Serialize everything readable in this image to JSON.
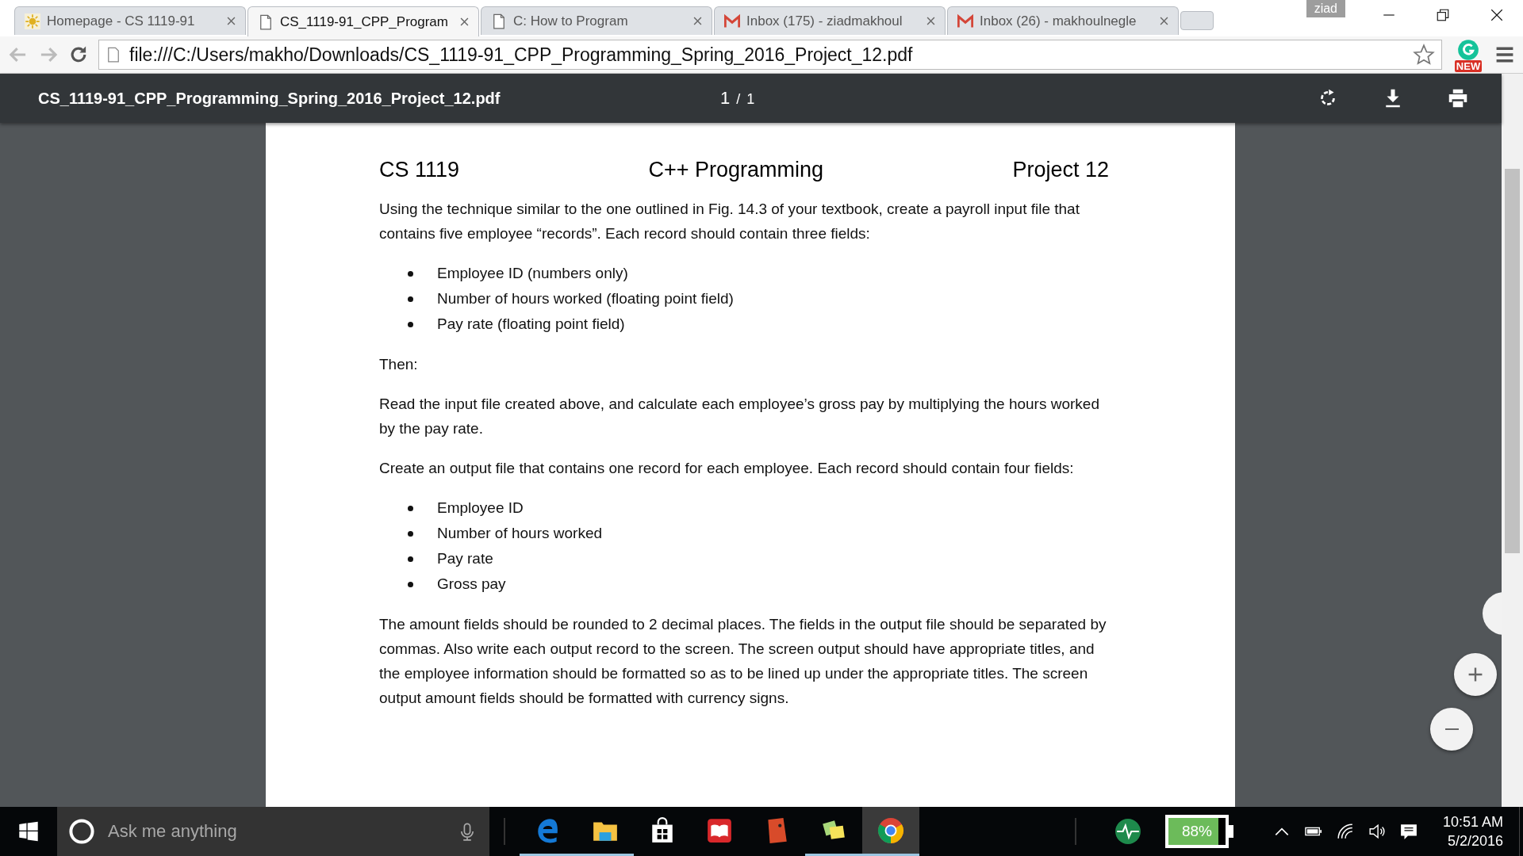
{
  "browser": {
    "tabs": [
      {
        "title": "Homepage - CS 1119-91",
        "kind": "site",
        "selected": false
      },
      {
        "title": "CS_1119-91_CPP_Program",
        "kind": "document",
        "selected": true
      },
      {
        "title": "C: How to Program",
        "kind": "document",
        "selected": false
      },
      {
        "title": "Inbox (175) - ziadmakhoul",
        "kind": "mail",
        "selected": false
      },
      {
        "title": "Inbox (26) - makhoulnegle",
        "kind": "mail",
        "selected": false
      }
    ],
    "profile_name": "ziad",
    "address": "file:///C:/Users/makho/Downloads/CS_1119-91_CPP_Programming_Spring_2016_Project_12.pdf",
    "extension_badge": "NEW"
  },
  "pdf_viewer": {
    "file_name": "CS_1119-91_CPP_Programming_Spring_2016_Project_12.pdf",
    "page_current": "1",
    "page_separator": "/",
    "page_total": "1",
    "document": {
      "heading": [
        "CS 1119",
        "C++ Programming",
        "Project 12"
      ],
      "blocks": [
        {
          "kind": "paragraph",
          "text": "Using the technique similar to the one outlined in Fig. 14.3 of your textbook, create a payroll input file that contains five employee “records”. Each record should contain three fields:"
        },
        {
          "kind": "list",
          "items": [
            "Employee ID (numbers only)",
            "Number of hours worked (floating point field)",
            "Pay rate (floating point field)"
          ]
        },
        {
          "kind": "paragraph",
          "text": "Then:"
        },
        {
          "kind": "paragraph",
          "text": "Read the input file created above, and calculate each employee’s gross pay by multiplying the hours worked by the pay rate."
        },
        {
          "kind": "paragraph",
          "text": "Create an output file that contains one record for each employee. Each record should contain four fields:"
        },
        {
          "kind": "list",
          "items": [
            "Employee ID",
            "Number of hours worked",
            "Pay rate",
            "Gross pay"
          ]
        },
        {
          "kind": "paragraph",
          "text": "The amount fields should be rounded to 2 decimal places. The fields in the output file should be separated by commas. Also write each output record to the screen. The screen output should have appropriate titles, and the employee information should be formatted so as to be lined up under the appropriate titles. The screen output amount fields should be formatted with currency signs."
        }
      ]
    }
  },
  "taskbar": {
    "search_placeholder": "Ask me anything",
    "apps": [
      {
        "kind": "edge",
        "running": true,
        "selected": false
      },
      {
        "kind": "explorer",
        "running": true,
        "selected": false
      },
      {
        "kind": "store",
        "running": false,
        "selected": false
      },
      {
        "kind": "reader",
        "running": false,
        "selected": false
      },
      {
        "kind": "red-app",
        "running": false,
        "selected": false
      },
      {
        "kind": "notes",
        "running": true,
        "selected": false
      },
      {
        "kind": "chrome",
        "running": true,
        "selected": true
      }
    ],
    "battery": {
      "reading": "88%",
      "level": 0.88
    },
    "clock": {
      "time": "10:51 AM",
      "date": "5/2/2016"
    }
  }
}
